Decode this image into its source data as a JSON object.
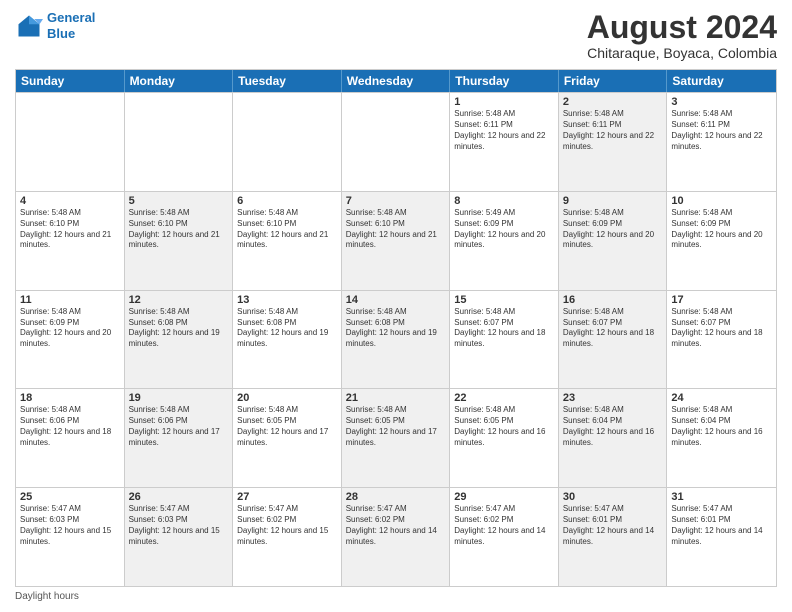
{
  "header": {
    "logo_line1": "General",
    "logo_line2": "Blue",
    "title": "August 2024",
    "subtitle": "Chitaraque, Boyaca, Colombia"
  },
  "days_of_week": [
    "Sunday",
    "Monday",
    "Tuesday",
    "Wednesday",
    "Thursday",
    "Friday",
    "Saturday"
  ],
  "weeks": [
    [
      {
        "day": "",
        "text": "",
        "shaded": false
      },
      {
        "day": "",
        "text": "",
        "shaded": false
      },
      {
        "day": "",
        "text": "",
        "shaded": false
      },
      {
        "day": "",
        "text": "",
        "shaded": false
      },
      {
        "day": "1",
        "text": "Sunrise: 5:48 AM\nSunset: 6:11 PM\nDaylight: 12 hours and 22 minutes.",
        "shaded": false
      },
      {
        "day": "2",
        "text": "Sunrise: 5:48 AM\nSunset: 6:11 PM\nDaylight: 12 hours and 22 minutes.",
        "shaded": true
      },
      {
        "day": "3",
        "text": "Sunrise: 5:48 AM\nSunset: 6:11 PM\nDaylight: 12 hours and 22 minutes.",
        "shaded": false
      }
    ],
    [
      {
        "day": "4",
        "text": "Sunrise: 5:48 AM\nSunset: 6:10 PM\nDaylight: 12 hours and 21 minutes.",
        "shaded": false
      },
      {
        "day": "5",
        "text": "Sunrise: 5:48 AM\nSunset: 6:10 PM\nDaylight: 12 hours and 21 minutes.",
        "shaded": true
      },
      {
        "day": "6",
        "text": "Sunrise: 5:48 AM\nSunset: 6:10 PM\nDaylight: 12 hours and 21 minutes.",
        "shaded": false
      },
      {
        "day": "7",
        "text": "Sunrise: 5:48 AM\nSunset: 6:10 PM\nDaylight: 12 hours and 21 minutes.",
        "shaded": true
      },
      {
        "day": "8",
        "text": "Sunrise: 5:49 AM\nSunset: 6:09 PM\nDaylight: 12 hours and 20 minutes.",
        "shaded": false
      },
      {
        "day": "9",
        "text": "Sunrise: 5:48 AM\nSunset: 6:09 PM\nDaylight: 12 hours and 20 minutes.",
        "shaded": true
      },
      {
        "day": "10",
        "text": "Sunrise: 5:48 AM\nSunset: 6:09 PM\nDaylight: 12 hours and 20 minutes.",
        "shaded": false
      }
    ],
    [
      {
        "day": "11",
        "text": "Sunrise: 5:48 AM\nSunset: 6:09 PM\nDaylight: 12 hours and 20 minutes.",
        "shaded": false
      },
      {
        "day": "12",
        "text": "Sunrise: 5:48 AM\nSunset: 6:08 PM\nDaylight: 12 hours and 19 minutes.",
        "shaded": true
      },
      {
        "day": "13",
        "text": "Sunrise: 5:48 AM\nSunset: 6:08 PM\nDaylight: 12 hours and 19 minutes.",
        "shaded": false
      },
      {
        "day": "14",
        "text": "Sunrise: 5:48 AM\nSunset: 6:08 PM\nDaylight: 12 hours and 19 minutes.",
        "shaded": true
      },
      {
        "day": "15",
        "text": "Sunrise: 5:48 AM\nSunset: 6:07 PM\nDaylight: 12 hours and 18 minutes.",
        "shaded": false
      },
      {
        "day": "16",
        "text": "Sunrise: 5:48 AM\nSunset: 6:07 PM\nDaylight: 12 hours and 18 minutes.",
        "shaded": true
      },
      {
        "day": "17",
        "text": "Sunrise: 5:48 AM\nSunset: 6:07 PM\nDaylight: 12 hours and 18 minutes.",
        "shaded": false
      }
    ],
    [
      {
        "day": "18",
        "text": "Sunrise: 5:48 AM\nSunset: 6:06 PM\nDaylight: 12 hours and 18 minutes.",
        "shaded": false
      },
      {
        "day": "19",
        "text": "Sunrise: 5:48 AM\nSunset: 6:06 PM\nDaylight: 12 hours and 17 minutes.",
        "shaded": true
      },
      {
        "day": "20",
        "text": "Sunrise: 5:48 AM\nSunset: 6:05 PM\nDaylight: 12 hours and 17 minutes.",
        "shaded": false
      },
      {
        "day": "21",
        "text": "Sunrise: 5:48 AM\nSunset: 6:05 PM\nDaylight: 12 hours and 17 minutes.",
        "shaded": true
      },
      {
        "day": "22",
        "text": "Sunrise: 5:48 AM\nSunset: 6:05 PM\nDaylight: 12 hours and 16 minutes.",
        "shaded": false
      },
      {
        "day": "23",
        "text": "Sunrise: 5:48 AM\nSunset: 6:04 PM\nDaylight: 12 hours and 16 minutes.",
        "shaded": true
      },
      {
        "day": "24",
        "text": "Sunrise: 5:48 AM\nSunset: 6:04 PM\nDaylight: 12 hours and 16 minutes.",
        "shaded": false
      }
    ],
    [
      {
        "day": "25",
        "text": "Sunrise: 5:47 AM\nSunset: 6:03 PM\nDaylight: 12 hours and 15 minutes.",
        "shaded": false
      },
      {
        "day": "26",
        "text": "Sunrise: 5:47 AM\nSunset: 6:03 PM\nDaylight: 12 hours and 15 minutes.",
        "shaded": true
      },
      {
        "day": "27",
        "text": "Sunrise: 5:47 AM\nSunset: 6:02 PM\nDaylight: 12 hours and 15 minutes.",
        "shaded": false
      },
      {
        "day": "28",
        "text": "Sunrise: 5:47 AM\nSunset: 6:02 PM\nDaylight: 12 hours and 14 minutes.",
        "shaded": true
      },
      {
        "day": "29",
        "text": "Sunrise: 5:47 AM\nSunset: 6:02 PM\nDaylight: 12 hours and 14 minutes.",
        "shaded": false
      },
      {
        "day": "30",
        "text": "Sunrise: 5:47 AM\nSunset: 6:01 PM\nDaylight: 12 hours and 14 minutes.",
        "shaded": true
      },
      {
        "day": "31",
        "text": "Sunrise: 5:47 AM\nSunset: 6:01 PM\nDaylight: 12 hours and 14 minutes.",
        "shaded": false
      }
    ]
  ],
  "footer": {
    "note": "Daylight hours"
  },
  "colors": {
    "header_bg": "#1a6fb5",
    "shaded_cell": "#f0f0f0"
  }
}
